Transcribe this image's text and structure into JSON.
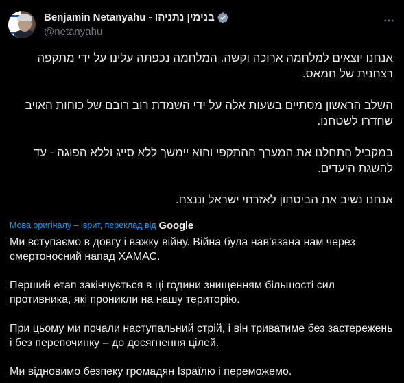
{
  "author": {
    "display_name": "Benjamin Netanyahu - בנימין נתניהו",
    "handle": "@netanyahu",
    "verified_icon": "verified-badge-icon",
    "more_icon": "more-horizontal-icon"
  },
  "post": {
    "original_paragraphs": [
      "אנחנו יוצאים למלחמה ארוכה וקשה. המלחמה נכפתה עלינו על ידי מתקפה רצחנית של חמאס.",
      "השלב הראשון מסתיים בשעות אלה על ידי השמדת רוב רובם של כוחות האויב שחדרו לשטחנו.",
      "במקביל התחלנו את המערך ההתקפי והוא יימשך ללא סייג וללא הפוגה - עד להשגת היעדים.",
      "אנחנו נשיב את הביטחון לאזרחי ישראל וננצח."
    ],
    "translation_note": "Мова оригіналу – іврит, переклад від",
    "translation_provider": "Google",
    "translated_paragraphs": [
      "Ми вступаємо в довгу і важку війну. Війна була нав’язана нам через смертоносний напад ХАМАС.",
      "Перший етап закінчується в ці години знищенням більшості сил противника, які проникли на нашу територію.",
      "При цьому ми почали наступальний стрій, і він триватиме без застережень і без перепочинку – до досягнення цілей.",
      "Ми відновимо безпеку громадян Ізраїлю і переможемо."
    ]
  },
  "colors": {
    "background": "#000000",
    "text": "#e7e9ea",
    "secondary_text": "#71767b",
    "link": "#1d9bf0",
    "verified_badge": "#829aab"
  }
}
